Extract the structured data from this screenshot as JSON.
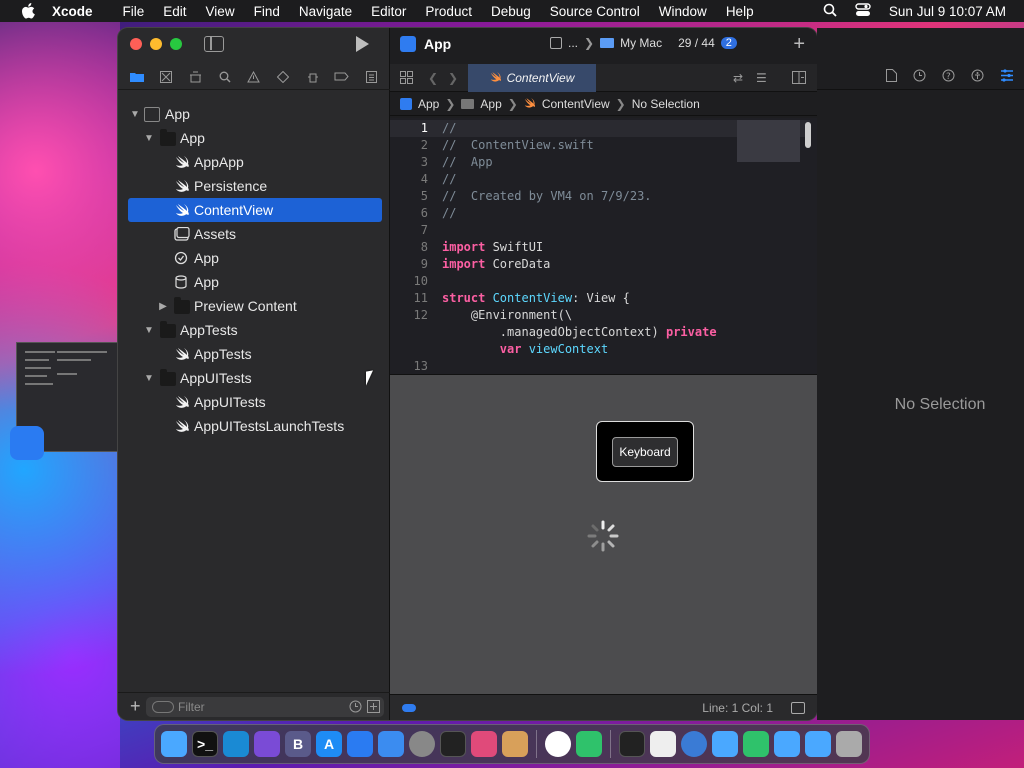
{
  "menubar": {
    "app_name": "Xcode",
    "items": [
      "File",
      "Edit",
      "View",
      "Find",
      "Navigate",
      "Editor",
      "Product",
      "Debug",
      "Source Control",
      "Window",
      "Help"
    ],
    "clock": "Sun Jul 9  10:07 AM"
  },
  "toolbar": {
    "project_title": "App",
    "scheme_target": "...",
    "destination": "My Mac",
    "counter": "29 / 44",
    "badge": "2"
  },
  "tab": {
    "label": "ContentView"
  },
  "breadcrumb": {
    "items": [
      "App",
      "App",
      "ContentView",
      "No Selection"
    ]
  },
  "navigator": {
    "items": [
      {
        "label": "App",
        "icon": "app-project-icon"
      },
      {
        "label": "App",
        "icon": "folder-icon"
      },
      {
        "label": "AppApp",
        "icon": "swift-file-icon"
      },
      {
        "label": "Persistence",
        "icon": "swift-file-icon"
      },
      {
        "label": "ContentView",
        "icon": "swift-file-icon",
        "selected": true
      },
      {
        "label": "Assets",
        "icon": "asset-catalog-icon"
      },
      {
        "label": "App",
        "icon": "entitlements-icon"
      },
      {
        "label": "App",
        "icon": "core-data-model-icon"
      },
      {
        "label": "Preview Content",
        "icon": "folder-icon"
      },
      {
        "label": "AppTests",
        "icon": "folder-icon"
      },
      {
        "label": "AppTests",
        "icon": "swift-file-icon"
      },
      {
        "label": "AppUITests",
        "icon": "folder-icon"
      },
      {
        "label": "AppUITests",
        "icon": "swift-file-icon"
      },
      {
        "label": "AppUITestsLaunchTests",
        "icon": "swift-file-icon"
      }
    ],
    "filter_placeholder": "Filter"
  },
  "code": {
    "lines": [
      {
        "n": "1",
        "text": "//"
      },
      {
        "n": "2",
        "text": "//  ContentView.swift"
      },
      {
        "n": "3",
        "text": "//  App"
      },
      {
        "n": "4",
        "text": "//"
      },
      {
        "n": "5",
        "text": "//  Created by VM4 on 7/9/23."
      },
      {
        "n": "6",
        "text": "//"
      },
      {
        "n": "7",
        "text": ""
      },
      {
        "n": "8",
        "kw": "import",
        "rest": " SwiftUI"
      },
      {
        "n": "9",
        "kw": "import",
        "rest": " CoreData"
      },
      {
        "n": "10",
        "text": ""
      },
      {
        "n": "11",
        "kw": "struct",
        "type": " ContentView",
        "rest": ": View {"
      },
      {
        "n": "12",
        "attr": "    @Environment(\\"
      },
      {
        "n": "",
        "text": "        .managedObjectContext)",
        "kw2": " private"
      },
      {
        "n": "",
        "kw": "        var",
        "type": " viewContext"
      },
      {
        "n": "13",
        "text": ""
      }
    ]
  },
  "preview": {
    "keyboard_button": "Keyboard"
  },
  "status": {
    "position": "Line: 1  Col: 1"
  },
  "inspector": {
    "empty_label": "No Selection"
  },
  "colors": {
    "accent": "#1d62d6",
    "keyword": "#fc5fa3",
    "type": "#5dd8ff",
    "comment": "#7f8c98"
  }
}
